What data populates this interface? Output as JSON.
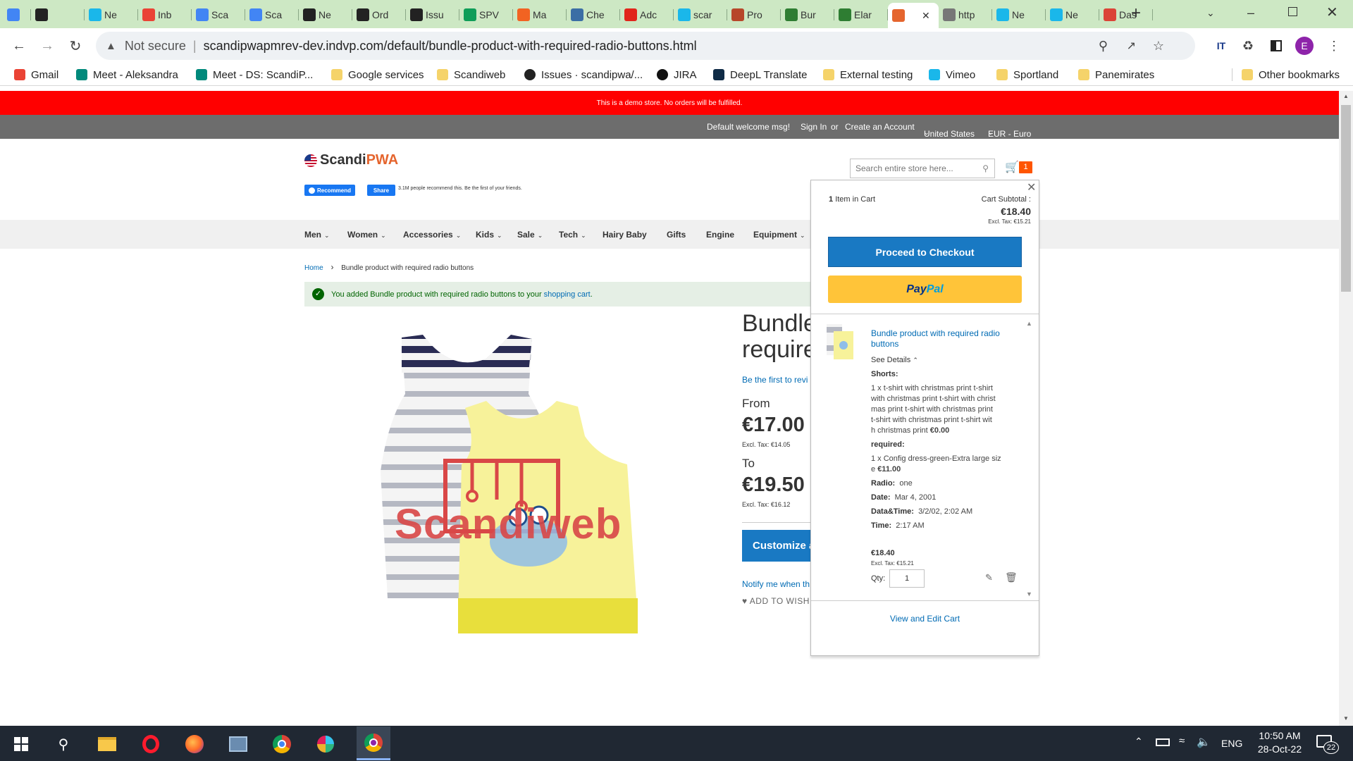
{
  "browser": {
    "tabs": [
      {
        "title": "",
        "icon": "docs-icon",
        "color": "#4285f4"
      },
      {
        "title": "",
        "icon": "github-icon",
        "color": "#222222"
      },
      {
        "title": "Ne",
        "icon": "vimeo-icon",
        "color": "#1ab7ea"
      },
      {
        "title": "Inb",
        "icon": "gmail-icon",
        "color": "#ea4335"
      },
      {
        "title": "Sca",
        "icon": "calendar-icon",
        "color": "#4285f4"
      },
      {
        "title": "Sca",
        "icon": "calendar-icon",
        "color": "#4285f4"
      },
      {
        "title": "Ne",
        "icon": "github-icon",
        "color": "#222222"
      },
      {
        "title": "Ord",
        "icon": "github-icon",
        "color": "#222222"
      },
      {
        "title": "Issu",
        "icon": "github-icon",
        "color": "#222222"
      },
      {
        "title": "SPV",
        "icon": "sheets-icon",
        "color": "#0f9d58"
      },
      {
        "title": "Ma",
        "icon": "magento-icon",
        "color": "#f26322"
      },
      {
        "title": "Che",
        "icon": "v-icon",
        "color": "#3b6ea5"
      },
      {
        "title": "Adc",
        "icon": "adobe-icon",
        "color": "#e1251b"
      },
      {
        "title": "scar",
        "icon": "vimeo-icon",
        "color": "#1ab7ea"
      },
      {
        "title": "Pro",
        "icon": "scandipwa-icon",
        "color": "#b7472a"
      },
      {
        "title": "Bur",
        "icon": "extension-icon",
        "color": "#2e7d32"
      },
      {
        "title": "Elar",
        "icon": "extension-icon",
        "color": "#2e7d32"
      },
      {
        "title": "",
        "icon": "scandipwa-icon",
        "color": "#e5652e",
        "active": true
      },
      {
        "title": "http",
        "icon": "cat-icon",
        "color": "#777777"
      },
      {
        "title": "Ne",
        "icon": "vimeo-icon",
        "color": "#1ab7ea"
      },
      {
        "title": "Ne",
        "icon": "vimeo-icon",
        "color": "#1ab7ea"
      },
      {
        "title": "Das",
        "icon": "chrome-icon",
        "color": "#db4437"
      }
    ],
    "url_warning": "Not secure",
    "url": "scandipwapmrev-dev.indvp.com/default/bundle-product-with-required-radio-buttons.html",
    "profile_initial": "E",
    "bookmarks": [
      {
        "label": "Gmail",
        "icon": "gmail-icon"
      },
      {
        "label": "Meet - Aleksandra",
        "icon": "meet-icon"
      },
      {
        "label": "Meet - DS: ScandiP...",
        "icon": "meet-icon"
      },
      {
        "label": "Google services",
        "icon": "folder-icon"
      },
      {
        "label": "Scandiweb",
        "icon": "folder-icon"
      },
      {
        "label": "Issues · scandipwa/...",
        "icon": "github-icon"
      },
      {
        "label": "JIRA",
        "icon": "jira-icon"
      },
      {
        "label": "DeepL Translate",
        "icon": "deepl-icon"
      },
      {
        "label": "External testing",
        "icon": "folder-icon"
      },
      {
        "label": "Vimeo",
        "icon": "vimeo-icon"
      },
      {
        "label": "Sportland",
        "icon": "folder-icon"
      },
      {
        "label": "Panemirates",
        "icon": "folder-icon"
      },
      {
        "label": "Other bookmarks",
        "icon": "folder-icon"
      }
    ]
  },
  "store": {
    "demo_notice": "This is a demo store. No orders will be fulfilled.",
    "welcome": "Default welcome msg!",
    "sign_in": "Sign In",
    "or": "or",
    "create_account": "Create an Account",
    "country": "United States",
    "currency": "EUR - Euro",
    "logo_text": "ScandiPWA",
    "logo_scandi": "Scandi",
    "logo_pwa": "PWA",
    "fb_recommend": "Recommend",
    "fb_share": "Share",
    "fb_text": "3.1M people recommend this. Be the first of your friends.",
    "search_placeholder": "Search entire store here...",
    "cart_count": "1",
    "nav": [
      {
        "label": "Men",
        "chevron": true
      },
      {
        "label": "Women",
        "chevron": true
      },
      {
        "label": "Accessories",
        "chevron": true
      },
      {
        "label": "Kids",
        "chevron": true
      },
      {
        "label": "Sale",
        "chevron": true
      },
      {
        "label": "Tech",
        "chevron": true
      },
      {
        "label": "Hairy Baby",
        "chevron": false
      },
      {
        "label": "Gifts",
        "chevron": false
      },
      {
        "label": "Engine",
        "chevron": false
      },
      {
        "label": "Equipment",
        "chevron": true
      }
    ],
    "breadcrumb_home": "Home",
    "breadcrumb_current": "Bundle product with required radio buttons",
    "success_prefix": "You added Bundle product with required radio buttons to your ",
    "success_link": "shopping cart",
    "success_suffix": ".",
    "watermark": "Scandiweb",
    "product": {
      "title_line1": "Bundle",
      "title_line2": "require",
      "review_link": "Be the first to revi",
      "from_label": "From",
      "from_price": "€17.00",
      "from_excl": "Excl. Tax: €14.05",
      "to_label": "To",
      "to_price": "€19.50",
      "to_excl": "Excl. Tax: €16.12",
      "customize": "Customize a",
      "notify": "Notify me when th",
      "wishlist": "ADD TO WISH"
    }
  },
  "minicart": {
    "items_count": "1",
    "items_label": "Item in Cart",
    "subtotal_label": "Cart Subtotal :",
    "subtotal": "€18.40",
    "subtotal_excl": "Excl. Tax: €15.21",
    "checkout": "Proceed to Checkout",
    "paypal_pay": "Pay",
    "paypal_pal": "Pal",
    "item_name_1": "Bundle product with required radio",
    "item_name_2": "buttons",
    "see_details": "See Details",
    "shorts_label": "Shorts:",
    "shorts_lines": [
      "1 x t-shirt with christmas print t-shirt",
      "with christmas print t-shirt with christ",
      "mas print t-shirt with christmas print",
      "t-shirt with christmas print t-shirt wit",
      "h christmas print"
    ],
    "shorts_price": "€0.00",
    "required_label": "required:",
    "required_lines": [
      "1 x Config dress-green-Extra large siz",
      "e"
    ],
    "required_price": "€11.00",
    "radio_label": "Radio:",
    "radio_value": "one",
    "date_label": "Date:",
    "date_value": "Mar 4, 2001",
    "datetime_label": "Data&Time:",
    "datetime_value": "3/2/02, 2:02 AM",
    "time_label": "Time:",
    "time_value": "2:17 AM",
    "item_price": "€18.40",
    "item_excl": "Excl. Tax: €15.21",
    "qty_label": "Qty:",
    "qty_value": "1",
    "view_edit": "View and Edit Cart"
  },
  "taskbar": {
    "language": "ENG",
    "time": "10:50 AM",
    "date": "28-Oct-22",
    "notifications": "22"
  }
}
